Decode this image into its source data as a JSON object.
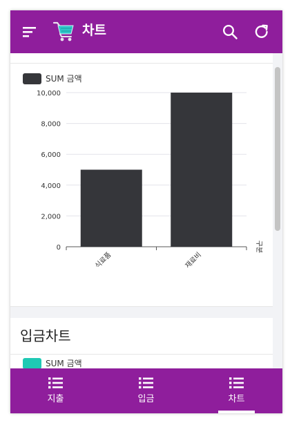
{
  "header": {
    "title": "차트",
    "background": "#8f1e9c",
    "icons": [
      "menu-icon",
      "cart-icon",
      "search-icon",
      "refresh-icon"
    ]
  },
  "expense_chart": {
    "legend": {
      "label": "SUM 금액",
      "color": "#35363a"
    },
    "chart_data": {
      "type": "bar",
      "categories": [
        "식료품",
        "재료비"
      ],
      "series": [
        {
          "name": "SUM 금액",
          "values": [
            5000,
            10000
          ]
        }
      ],
      "yticks": [
        "0",
        "2,000",
        "4,000",
        "6,000",
        "8,000",
        "10,000"
      ],
      "ylim": [
        0,
        10000
      ],
      "xlabel": "구분",
      "ylabel": "",
      "grid": true,
      "legend_position": "top-left"
    }
  },
  "income_chart": {
    "title": "입금차트",
    "legend": {
      "label": "SUM 금액",
      "color": "#1fc9b4"
    }
  },
  "bottom_nav": {
    "tabs": [
      {
        "label": "지출",
        "icon": "list-icon",
        "active": false
      },
      {
        "label": "입금",
        "icon": "list-icon",
        "active": false
      },
      {
        "label": "차트",
        "icon": "list-icon",
        "active": true
      }
    ]
  }
}
